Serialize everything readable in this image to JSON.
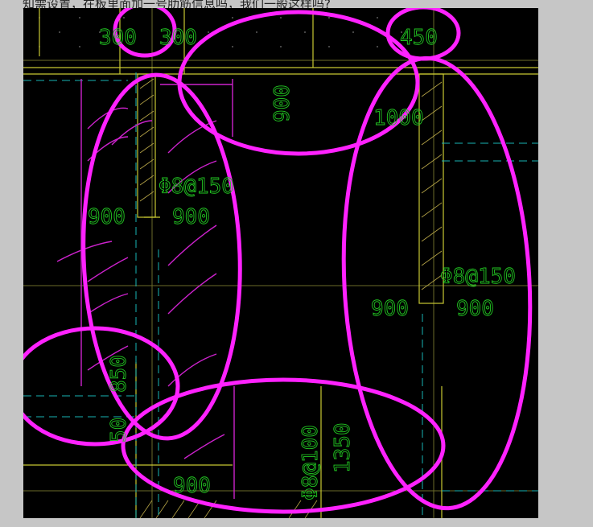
{
  "caption": "知需设置，在板里面加一号肋筋信息吗，我们一般这样吗?",
  "colors": {
    "background": "#000000",
    "dimension_text": "#22c822",
    "wall": "#c8c832",
    "axis": "#6b6b2a",
    "hatch": "#b8a648",
    "cyan": "#19b4b4",
    "markup": "#ff22ff"
  },
  "labels": {
    "top_dim_1": "300",
    "top_dim_2": "300",
    "top_dim_3": "450",
    "mid_dim_900_v": "900",
    "right_dim_1000": "1000",
    "rebar_left": "Φ8@150",
    "rebar_right": "Φ8@150",
    "rebar_bottom": "Φ8@100",
    "dim_900_a": "900",
    "dim_900_b": "900",
    "dim_900_c": "900",
    "dim_900_d": "900",
    "dim_900_e": "900",
    "dim_850": "850",
    "dim_50": "50",
    "dim_1350": "1350"
  }
}
